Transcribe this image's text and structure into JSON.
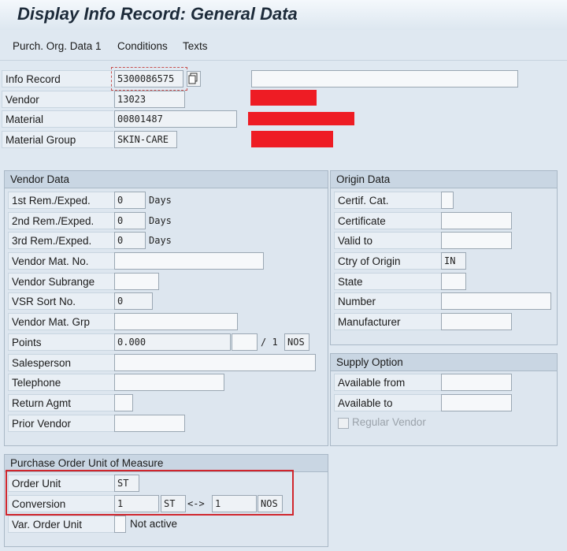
{
  "title": "Display Info Record: General Data",
  "toolbar": {
    "btn1": "Purch. Org. Data 1",
    "btn2": "Conditions",
    "btn3": "Texts"
  },
  "header": {
    "info_record_label": "Info Record",
    "info_record_value": "5300086575",
    "vendor_label": "Vendor",
    "vendor_value": "13023",
    "material_label": "Material",
    "material_value": "00801487",
    "material_group_label": "Material Group",
    "material_group_value": "SKIN-CARE"
  },
  "vendor_data": {
    "title": "Vendor Data",
    "rem1_label": "1st Rem./Exped.",
    "rem1_value": "0",
    "rem2_label": "2nd Rem./Exped.",
    "rem2_value": "0",
    "rem3_label": "3rd Rem./Exped.",
    "rem3_value": "0",
    "days": "Days",
    "vendor_mat_no_label": "Vendor Mat. No.",
    "vendor_subrange_label": "Vendor Subrange",
    "vsr_sort_label": "VSR Sort No.",
    "vsr_sort_value": "0",
    "vendor_mat_grp_label": "Vendor Mat. Grp",
    "points_label": "Points",
    "points_value": "0.000",
    "points_per": "/ 1",
    "points_unit": "NOS",
    "salesperson_label": "Salesperson",
    "telephone_label": "Telephone",
    "return_agmt_label": "Return Agmt",
    "prior_vendor_label": "Prior Vendor"
  },
  "origin_data": {
    "title": "Origin Data",
    "certif_cat_label": "Certif. Cat.",
    "certificate_label": "Certificate",
    "valid_to_label": "Valid to",
    "ctry_label": "Ctry of Origin",
    "ctry_value": "IN",
    "state_label": "State",
    "number_label": "Number",
    "manufacturer_label": "Manufacturer"
  },
  "supply_option": {
    "title": "Supply Option",
    "avail_from_label": "Available from",
    "avail_to_label": "Available to",
    "regular_vendor_label": "Regular Vendor"
  },
  "po_unit": {
    "title": "Purchase Order Unit of Measure",
    "order_unit_label": "Order Unit",
    "order_unit_value": "ST",
    "conversion_label": "Conversion",
    "conv_left_value": "1",
    "conv_left_unit": "ST",
    "conv_arrow": "<->",
    "conv_right_value": "1",
    "conv_right_unit": "NOS",
    "var_order_unit_label": "Var. Order Unit",
    "var_order_unit_text": "Not active"
  },
  "colors": {
    "redaction": "#ee1c24",
    "highlight": "#d0262d",
    "group_header": "#c9d6e3"
  }
}
